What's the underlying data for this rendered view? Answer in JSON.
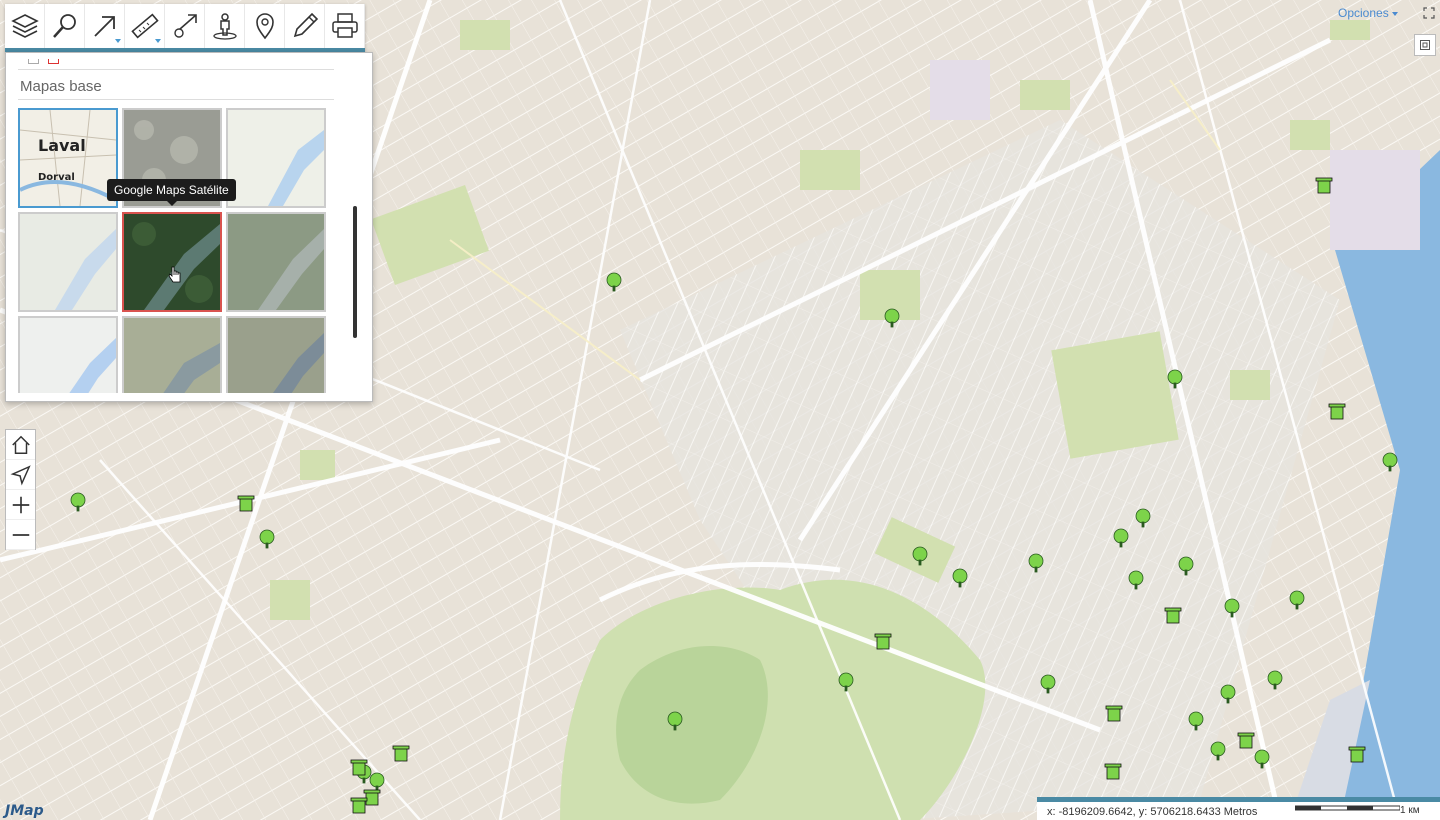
{
  "toolbar": {
    "tools": [
      {
        "name": "layers-icon",
        "dropdown": false
      },
      {
        "name": "search-icon",
        "dropdown": false
      },
      {
        "name": "select-arrow-icon",
        "dropdown": true
      },
      {
        "name": "measure-ruler-icon",
        "dropdown": true
      },
      {
        "name": "location-arrow-icon",
        "dropdown": false
      },
      {
        "name": "street-view-icon",
        "dropdown": false
      },
      {
        "name": "map-marker-icon",
        "dropdown": false
      },
      {
        "name": "edit-pencil-icon",
        "dropdown": false
      },
      {
        "name": "print-icon",
        "dropdown": false
      }
    ]
  },
  "basemaps": {
    "title": "Mapas base",
    "tooltip": "Google Maps Satélite",
    "tiles": [
      {
        "id": "streets",
        "label": "Laval",
        "sublabel": "Dorval",
        "selected": true
      },
      {
        "id": "imagery-gray"
      },
      {
        "id": "light-terrain"
      },
      {
        "id": "light-gray"
      },
      {
        "id": "google-satellite",
        "hover": true
      },
      {
        "id": "satellite-muted"
      },
      {
        "id": "light-blue"
      },
      {
        "id": "terrain-green"
      },
      {
        "id": "terrain-satellite"
      }
    ]
  },
  "nav": {
    "home": "home-icon",
    "locate": "locate-arrow-icon",
    "zoom_in": "zoom-in-icon",
    "zoom_out": "zoom-out-icon"
  },
  "opciones_label": "Opciones",
  "coords_text": "x: -8196209.6642, y: 5706218.6433 Metros",
  "scale_label": "1 км",
  "logo_text": "JMap",
  "colors": {
    "accent": "#4a8aa4",
    "link": "#4a8ad0",
    "map_bg": "#ece6dc",
    "park": "#cddcaa",
    "water": "#8ab8e0"
  }
}
